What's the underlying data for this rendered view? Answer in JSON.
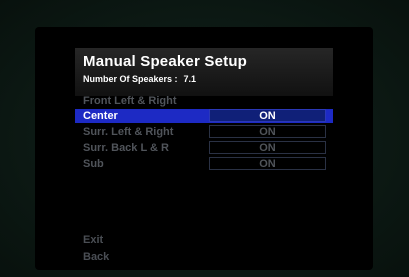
{
  "menu": {
    "title": "Manual Speaker Setup",
    "speakers_label": "Number Of Speakers :",
    "speakers_value": "7.1",
    "items": [
      {
        "label": "Front Left & Right",
        "value": ""
      },
      {
        "label": "Center",
        "value": "ON"
      },
      {
        "label": "Surr. Left & Right",
        "value": "ON"
      },
      {
        "label": "Surr. Back L & R",
        "value": "ON"
      },
      {
        "label": "Sub",
        "value": "ON"
      }
    ],
    "exit_label": "Exit",
    "back_label": "Back"
  },
  "colors": {
    "highlight": "#1d2ac4",
    "dim_text": "#50545a"
  }
}
